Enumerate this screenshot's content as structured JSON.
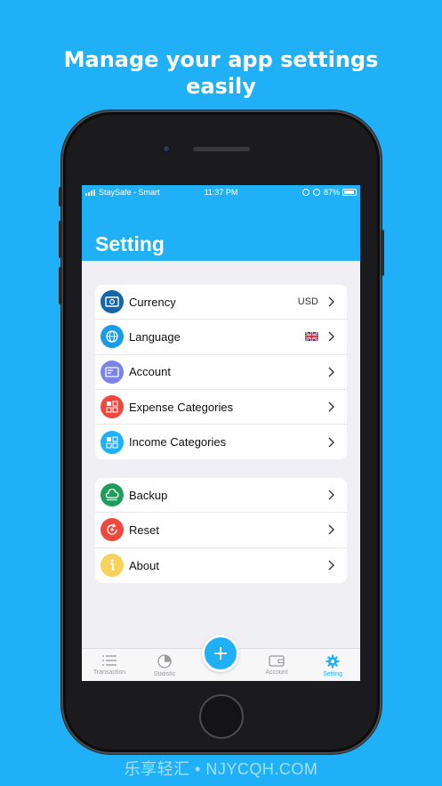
{
  "promo": {
    "headline_line1": "Manage your app settings",
    "headline_line2": "easily"
  },
  "statusbar": {
    "carrier": "StaySafe - Smart",
    "time": "11:37 PM",
    "battery": "87%"
  },
  "navbar": {
    "title": "Setting"
  },
  "settings": {
    "group1": [
      {
        "label": "Currency",
        "value": "USD",
        "icon": "currency-icon",
        "color": "#1565a8"
      },
      {
        "label": "Language",
        "value": "",
        "icon": "globe-icon",
        "color": "#1a9be6",
        "flag": "uk-flag-icon"
      },
      {
        "label": "Account",
        "value": "",
        "icon": "card-icon",
        "color": "#7c83e8"
      },
      {
        "label": "Expense Categories",
        "value": "",
        "icon": "categories-icon",
        "color": "#f0483e"
      },
      {
        "label": "Income Categories",
        "value": "",
        "icon": "categories-icon",
        "color": "#1fb0f7"
      }
    ],
    "group2": [
      {
        "label": "Backup",
        "icon": "backup-icon",
        "color": "#1e9e5a"
      },
      {
        "label": "Reset",
        "icon": "reset-icon",
        "color": "#f0483e"
      },
      {
        "label": "About",
        "icon": "info-icon",
        "color": "#f9d25b"
      }
    ]
  },
  "tabbar": {
    "tabs": [
      {
        "label": "Transaction",
        "icon": "list-icon",
        "active": false
      },
      {
        "label": "Statistic",
        "icon": "pie-chart-icon",
        "active": false
      },
      {
        "label": "Account",
        "icon": "wallet-icon",
        "active": false
      },
      {
        "label": "Setting",
        "icon": "gear-icon",
        "active": true
      }
    ],
    "fab_icon": "plus-icon"
  },
  "watermark": "乐享轻汇 • NJYCQH.COM",
  "colors": {
    "accent": "#1fb0f7",
    "background": "#efeff4"
  }
}
